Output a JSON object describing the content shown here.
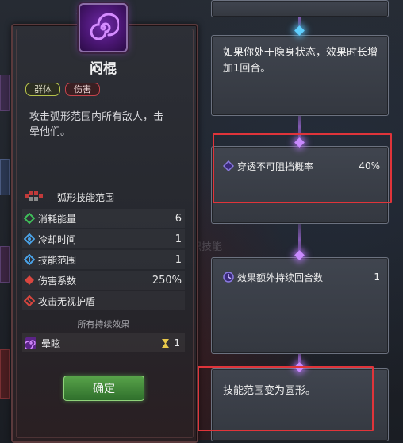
{
  "skill": {
    "name": "闷棍",
    "tags": [
      "群体",
      "伤害"
    ],
    "description": "攻击弧形范围内所有敌人，击晕他们。",
    "range_label": "弧形技能范围",
    "stats": [
      {
        "name": "消耗能量",
        "value": "6",
        "icon": "energy-icon",
        "color": "#3fbf5a"
      },
      {
        "name": "冷却时间",
        "value": "1",
        "icon": "cooldown-icon",
        "color": "#4aa3e8"
      },
      {
        "name": "技能范围",
        "value": "1",
        "icon": "range-icon",
        "color": "#4aa3e8"
      },
      {
        "name": "伤害系数",
        "value": "250%",
        "icon": "damage-icon",
        "color": "#d9463f"
      },
      {
        "name": "攻击无视护盾",
        "value": "",
        "icon": "shield-break-icon",
        "color": "#d9463f"
      }
    ],
    "all_effects_label": "所有持续效果",
    "effect": {
      "name": "晕眩",
      "duration": "1",
      "icon": "stun-icon"
    },
    "confirm_label": "确定"
  },
  "cards": [
    {
      "text": "如果你处于隐身状态，效果时长增加1回合。"
    },
    {
      "name": "穿透不可阻挡概率",
      "value": "40%"
    },
    {
      "name": "效果额外持续回合数",
      "value": "1"
    },
    {
      "text": "技能范围变为圆形。"
    }
  ],
  "colors": {
    "accent_purple": "#7b2fb8",
    "highlight_red": "#e0343a",
    "confirm_green": "#4f9a43"
  }
}
